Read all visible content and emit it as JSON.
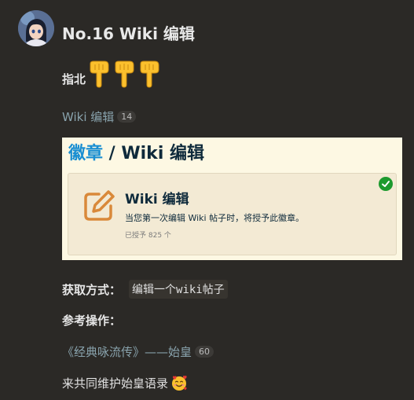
{
  "post": {
    "title": "No.16 Wiki 编辑",
    "pointer_label": "指北",
    "pointer_icon": "backhand-index-pointing-down-icon",
    "wiki_link": {
      "text": "Wiki 编辑",
      "count": "14"
    },
    "badge_card": {
      "heading_link": "徽章",
      "heading_sep": " / ",
      "heading_rest": "Wiki 编辑",
      "badge_name": "Wiki 编辑",
      "badge_description": "当您第一次编辑 Wiki 帖子时，将授予此徽章。",
      "granted_text": "已授予 825 个",
      "granted_icon": "check-circle-icon",
      "badge_icon": "edit-pencil-icon"
    },
    "method_label": "获取方式：",
    "method_value": "编辑一个wiki帖子",
    "reference_label": "参考操作：",
    "reference_link": {
      "text": "《经典咏流传》——始皇",
      "count": "60"
    },
    "footer_text": "来共同维护始皇语录",
    "footer_emoji": "smiling-face-with-hearts-icon"
  },
  "colors": {
    "background": "#2b2926",
    "link": "#89a3ad",
    "card_bg": "#fdf8e3",
    "accent_blue": "#1b8fd2",
    "badge_orange": "#d9893a",
    "check_green": "#1d9a2e"
  }
}
